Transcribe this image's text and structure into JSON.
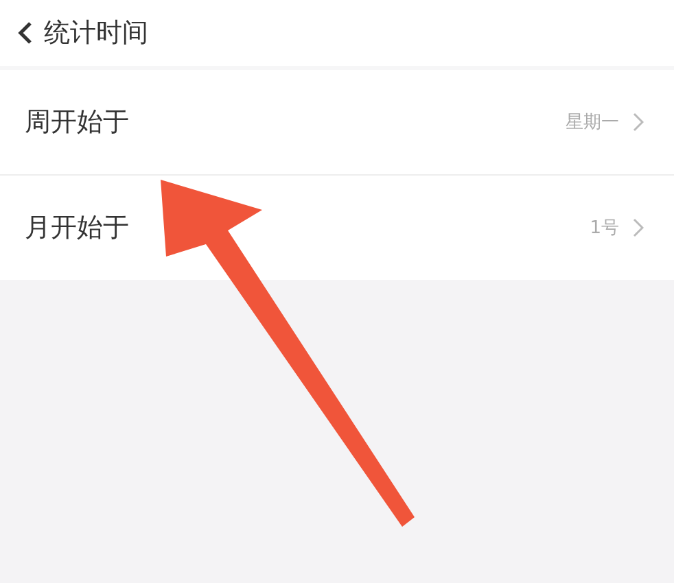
{
  "header": {
    "title": "统计时间"
  },
  "settings": [
    {
      "label": "周开始于",
      "value": "星期一"
    },
    {
      "label": "月开始于",
      "value": "1号"
    }
  ],
  "annotation": {
    "kind": "arrow"
  }
}
